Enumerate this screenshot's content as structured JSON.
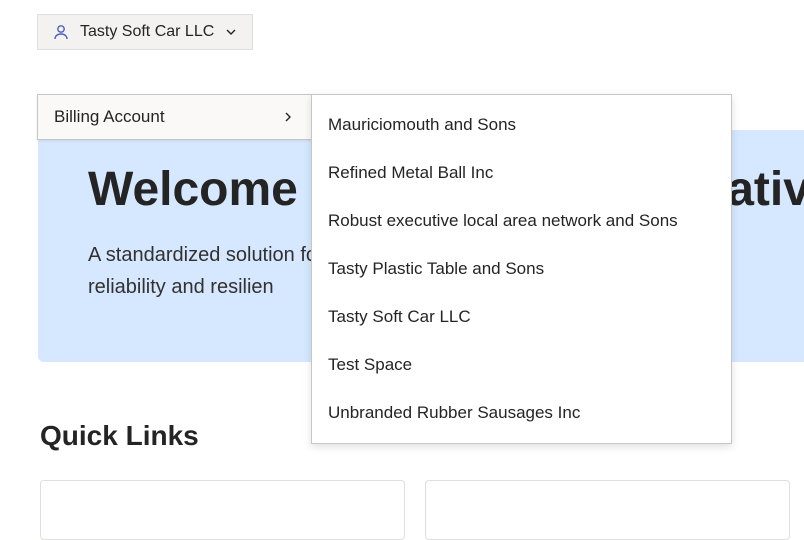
{
  "account_selector": {
    "current_label": "Tasty Soft Car LLC"
  },
  "dropdown_primary": {
    "item_label": "Billing Account"
  },
  "dropdown_secondary": {
    "items": [
      "Mauriciomouth and Sons",
      "Refined Metal Ball Inc",
      "Robust executive local area network and Sons",
      "Tasty Plastic Table and Sons",
      "Tasty Soft Car LLC",
      "Test Space",
      "Unbranded Rubber Sausages Inc"
    ]
  },
  "hero": {
    "title_full": "Welcome to the Digital Operative experience for fany",
    "subtitle_line1": "A standardized solution for building and managing oft to in",
    "subtitle_line2": "reliability and resilien"
  },
  "quick_links": {
    "heading": "Quick Links"
  }
}
